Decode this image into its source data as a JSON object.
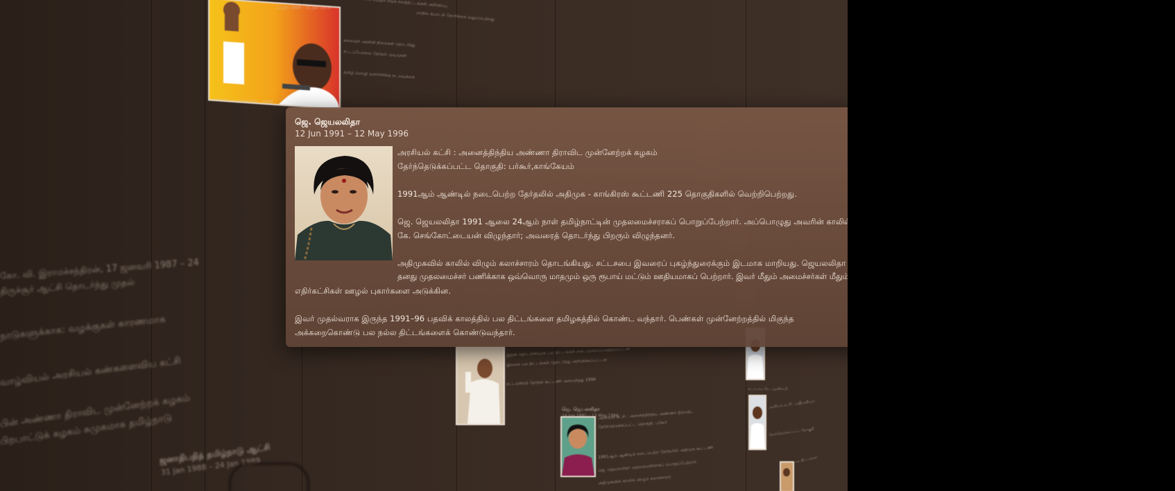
{
  "popup": {
    "name": "ஜெ. ஜெயலலிதா",
    "dates": "12 Jun 1991 – 12 May 1996",
    "party_line": "அரசியல் கட்சி : அனைத்திந்திய அண்ணா திராவிட முன்னேற்றக் கழகம்",
    "constituency_line": "தேர்ந்தெடுக்கப்பட்ட தொகுதி: பர்கூர்,காங்கேயம்",
    "p1": "1991ஆம் ஆண்டில் நடைபெற்ற தேர்தலில் அதிமுக - காங்கிரஸ் கூட்டணி 225 தொகுதிகளில் வெற்றிபெற்றது.",
    "p2_l1": "ஜெ. ஜெயலலிதா 1991 ஆலை 24ஆம் நாள் தமிழ்நாட்டின் முதலமைச்சராகப் பொறுப்பேற்றார். அப்பொழுது அவரின் காலில்",
    "p2_l2": "கே. செங்கோட்டையன் விழுந்தார்; அவரைத் தொடர்ந்து பிறரும் விழுந்தனர்.",
    "p3_l1": "அதிமுகவில் காலில் விழும் கலாச்சாரம் தொடங்கியது. சட்டசபை இவரைப் புகழ்ந்துரைக்கும் இடமாக மாறியது. ஜெயலலிதா",
    "p3_l2": "தனது முதலமைச்சர் பணிக்காக ஒவ்வொரு மாதமும் ஒரு ரூபாய் மட்டும் ஊதியமாகப் பெற்றார். இவர் மீதும் அமைச்சர்கள் மீதும்",
    "p3_l3": "எதிர்கட்சிகள் ஊழல் புகார்களை அடுக்கின.",
    "p4_l1": "இவர் முதல்வராக இருந்த 1991–96 பதவிக் காலத்தில் பல திட்டங்களை தமிழகத்தில் கொண்ட வந்தார். பெண்கள் முன்னேற்றத்தில் மிகுந்த",
    "p4_l2": "அக்கறைகொண்டு பல நல்ல திட்டங்களைக் கொண்டுவந்தார்."
  },
  "background": {
    "top_entry_date": "13 Jan 1969 – 31 Jan 1976",
    "mid_entry_title": "ஜெ. ஜெயலலிதா",
    "mid_entry_date": "24 Jun 1991 – 13 May 1996",
    "left_bottom_title": "ஜனாதிபதித் தமிழ்நாடு ஆட்சி",
    "left_bottom_date": "31 Jan 1988 – 24 Jan 1989",
    "left_lines": [
      "கோ. வி. இராமச்சந்திரன், 17 ஜனவரி 1987 – 24",
      "திருச்சூர் ஆட்சி தொடர்ந்து முதல்",
      "நாடுகளுக்காக: வழக்குகள் காரணமாக",
      "வாழ்வியல் அரசியல் கண்களைவிய கட்சி",
      "பின் அண்ணா திராவிட முன்னேற்றக் கழகம்",
      "பிறபாட்டுக் கழகம் சுமுகமாக தமிழ்நாடு"
    ],
    "top_lines": [
      "கலைஞர் அரசின் நிலைகள் தொடர்ந்து",
      "சட்டப்பேரவை தேர்தல் முடிவுகள்",
      "தமிழ் மொழி வளர்ச்சிக்கு நடவடிக்கை"
    ]
  }
}
